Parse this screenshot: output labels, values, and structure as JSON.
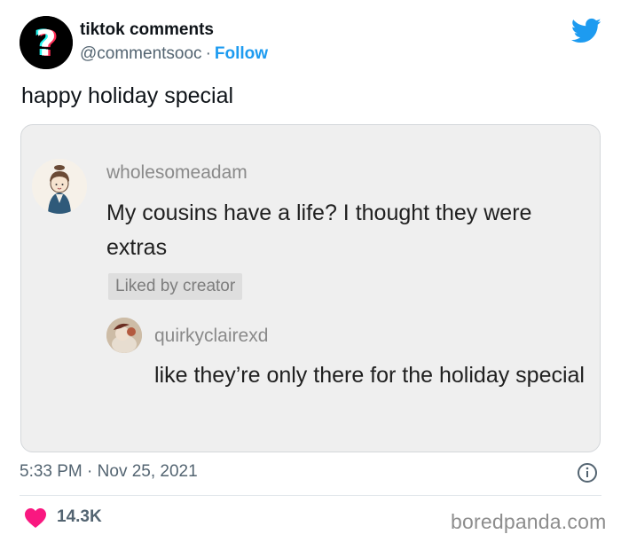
{
  "author": {
    "name": "tiktok comments",
    "handle": "@commentsooc",
    "separator": "·",
    "follow_label": "Follow",
    "avatar_icon": "tiktok-question-mark-logo"
  },
  "tweet": {
    "text": "happy holiday special"
  },
  "embedded_card": {
    "comment": {
      "username": "wholesomeadam",
      "text": "My cousins have a life? I thought they were extras",
      "badge": "Liked by creator"
    },
    "reply": {
      "username": "quirkyclairexd",
      "text": "like they’re only there for the holiday special"
    }
  },
  "footer": {
    "time": "5:33 PM",
    "separator": "·",
    "date": "Nov 25, 2021",
    "likes": "14.3K"
  },
  "watermark": "boredpanda.com",
  "colors": {
    "twitter_blue": "#1d9bf0",
    "heart_pink": "#f91880",
    "text_dark": "#0f1419",
    "text_muted": "#536471",
    "card_bg": "#efefef"
  }
}
